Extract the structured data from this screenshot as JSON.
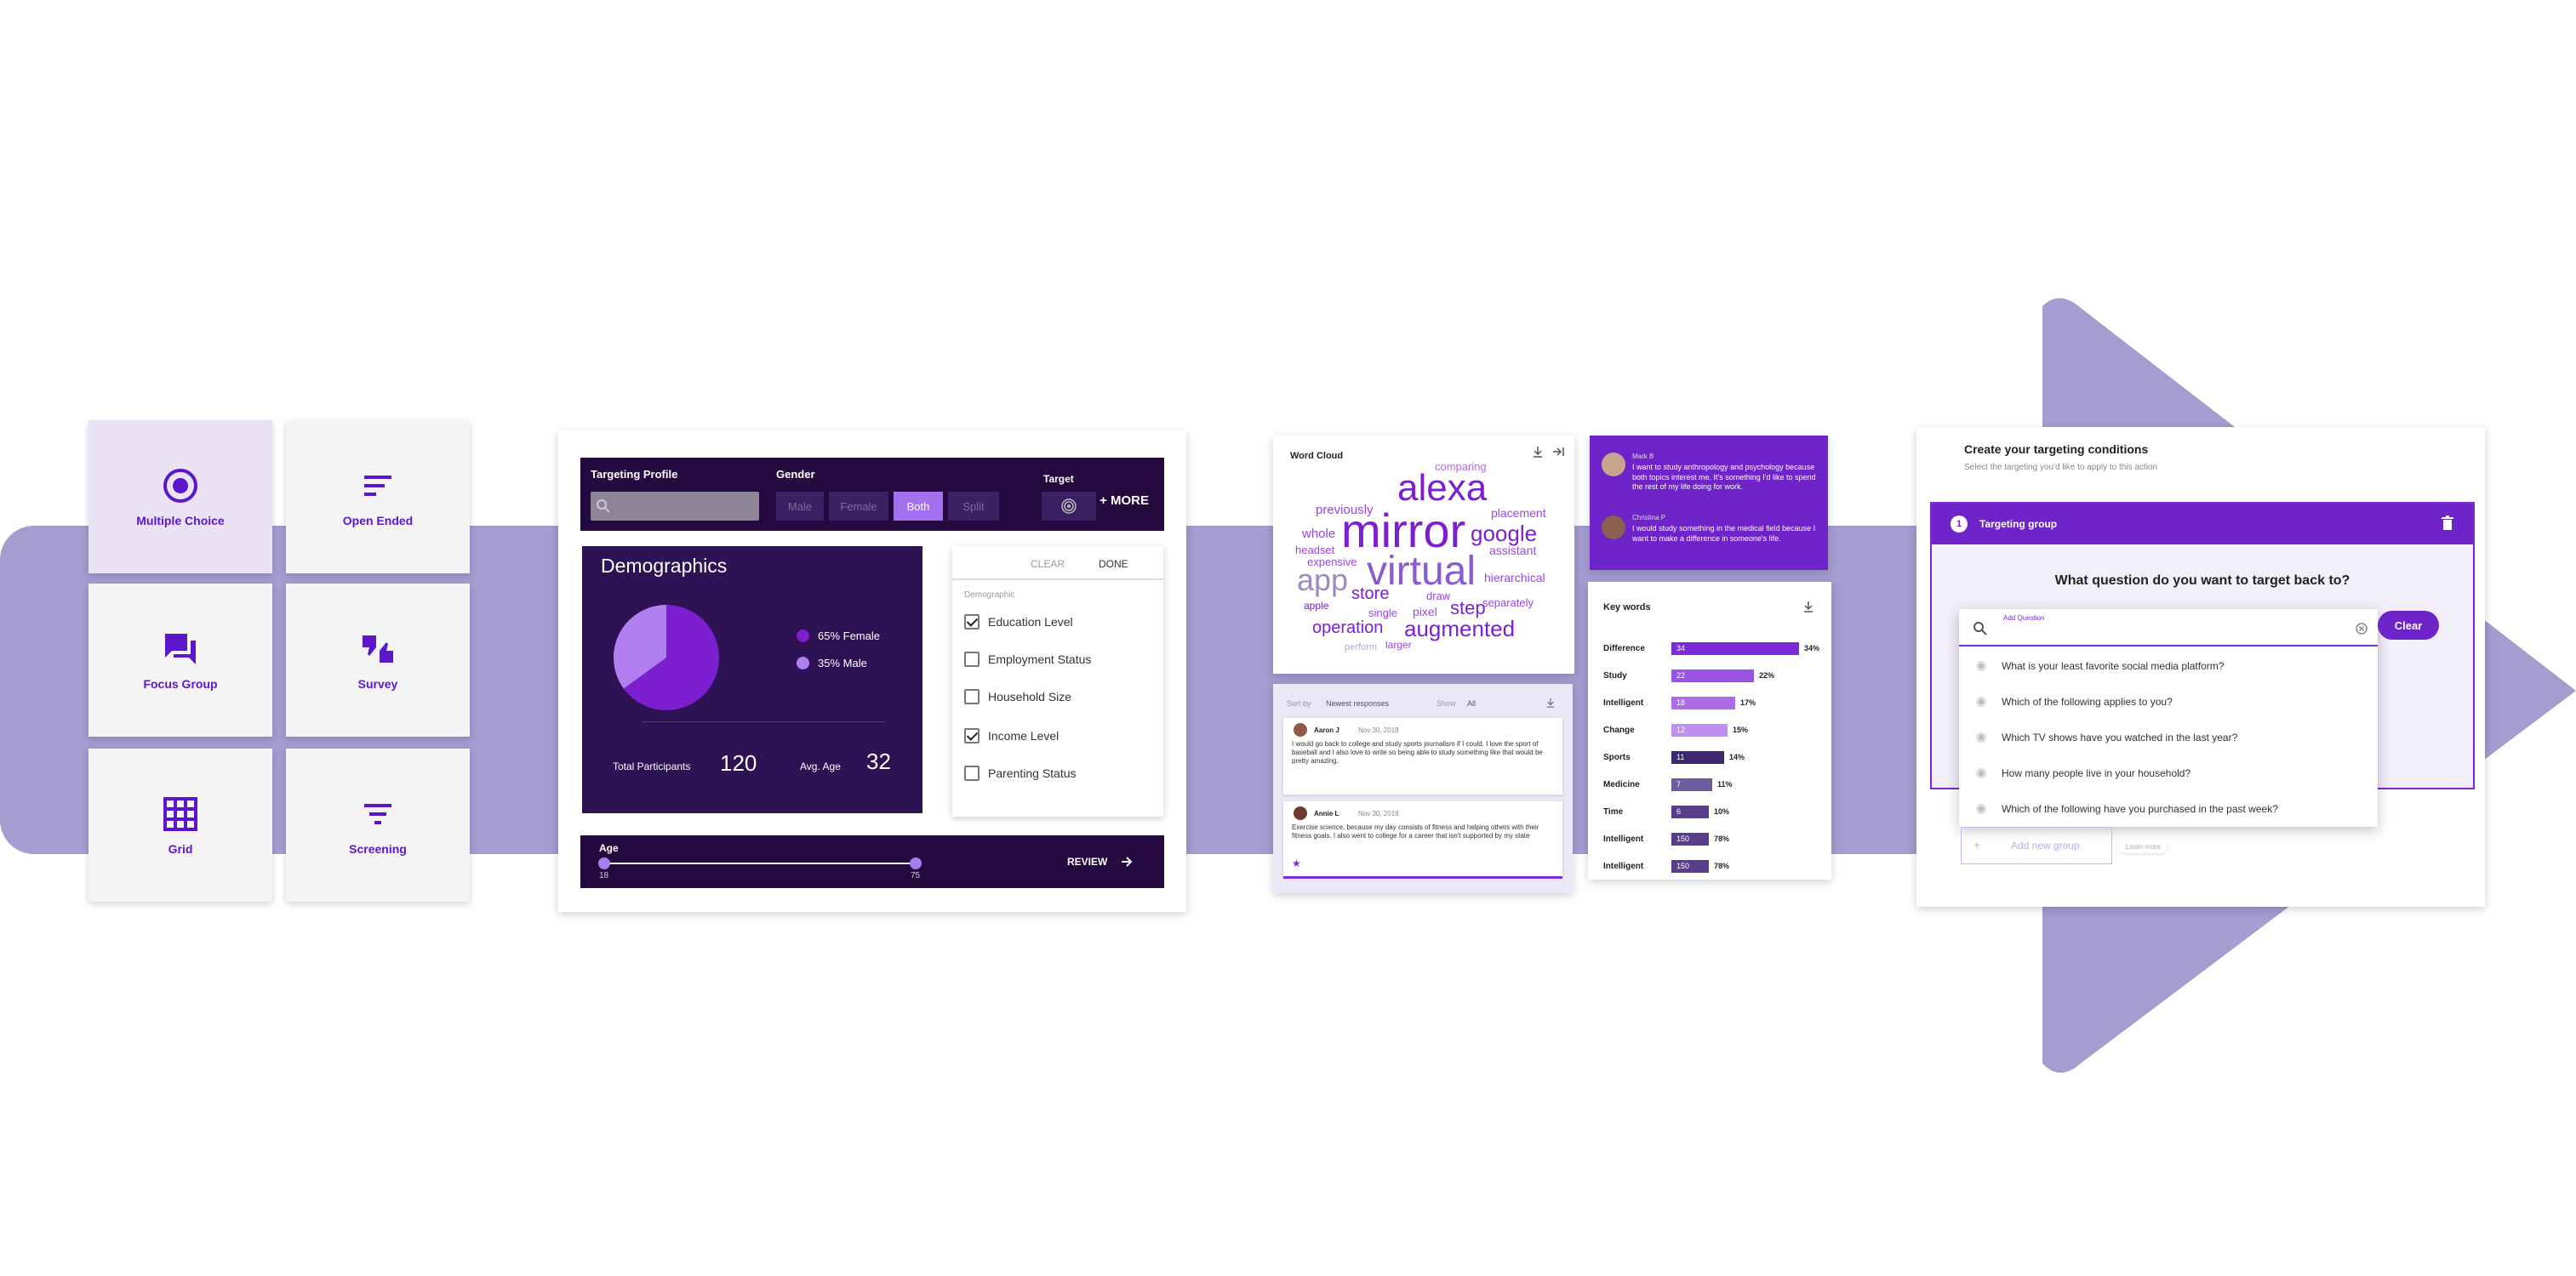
{
  "colors": {
    "accent": "#6e24c9",
    "dark": "#24093f",
    "background_band": "#a59cd0"
  },
  "question_types": [
    {
      "label": "Multiple Choice",
      "icon": "radio-icon",
      "selected": true
    },
    {
      "label": "Open Ended",
      "icon": "short-text-icon",
      "selected": false
    },
    {
      "label": "Focus Group",
      "icon": "forum-icon",
      "selected": false
    },
    {
      "label": "Survey",
      "icon": "thumbs-icon",
      "selected": false
    },
    {
      "label": "Grid",
      "icon": "grid-icon",
      "selected": false
    },
    {
      "label": "Screening",
      "icon": "filter-icon",
      "selected": false
    }
  ],
  "targeting": {
    "profile_label": "Targeting Profile",
    "gender_label": "Gender",
    "gender_options": [
      "Male",
      "Female",
      "Both",
      "Split"
    ],
    "gender_selected": "Both",
    "target_label": "Target",
    "more_label": "+ MORE"
  },
  "demographics": {
    "title": "Demographics",
    "legend": [
      "65% Female",
      "35% Male"
    ],
    "female_share": 0.65,
    "total_label": "Total Participants",
    "total_value": "120",
    "age_label": "Avg. Age",
    "age_value": "32"
  },
  "filters": {
    "clear_label": "CLEAR",
    "done_label": "DONE",
    "category": "Demographic",
    "items": [
      {
        "label": "Education Level",
        "checked": true
      },
      {
        "label": "Employment Status",
        "checked": false
      },
      {
        "label": "Household Size",
        "checked": false
      },
      {
        "label": "Income Level",
        "checked": true
      },
      {
        "label": "Parenting Status",
        "checked": false
      }
    ]
  },
  "age_range": {
    "label": "Age",
    "min": "18",
    "max": "75",
    "review_label": "REVIEW"
  },
  "word_cloud": {
    "title": "Word Cloud",
    "words": [
      "alexa",
      "mirror",
      "virtual",
      "google",
      "app",
      "augmented",
      "store",
      "step",
      "operation",
      "placement",
      "assistant",
      "hierarchical",
      "comparing",
      "previously",
      "whole",
      "headset",
      "expensive",
      "separately",
      "draw",
      "pixel",
      "single",
      "apple",
      "larger",
      "perform"
    ]
  },
  "responses": {
    "sort_label": "Sort by",
    "sort_value": "Newest responses",
    "show_label": "Show",
    "show_value": "All",
    "items": [
      {
        "name": "Aaron J",
        "date": "Nov 30, 2018",
        "text": "I would go back to college and study sports journalism if I could. I love the sport of baseball and I also love to write so being able to study something like that would be pretty amazing."
      },
      {
        "name": "Annie L",
        "date": "Nov 30, 2018",
        "text": "Exercise science, because my day consists of fitness and helping others with their fitness goals. I also went to college for a career that isn't supported by my state"
      }
    ]
  },
  "quotes": [
    {
      "name": "Mark B",
      "text": "I want to study anthropology and psychology because both topics interest me. It's something I'd like to spend the rest of my life doing for work."
    },
    {
      "name": "Christina P",
      "text": "I would study something in the medical field because I want to make a difference in someone's life."
    }
  ],
  "keywords": {
    "title": "Key words",
    "rows": [
      {
        "label": "Difference",
        "count": "34",
        "pct": "34%",
        "share": 0.34,
        "color": "#7b2bd6"
      },
      {
        "label": "Study",
        "count": "22",
        "pct": "22%",
        "share": 0.22,
        "color": "#9a53e3"
      },
      {
        "label": "Intelligent",
        "count": "18",
        "pct": "17%",
        "share": 0.17,
        "color": "#ad6be8"
      },
      {
        "label": "Change",
        "count": "12",
        "pct": "15%",
        "share": 0.15,
        "color": "#c08ff0"
      },
      {
        "label": "Sports",
        "count": "11",
        "pct": "14%",
        "share": 0.14,
        "color": "#3d2770"
      },
      {
        "label": "Medicine",
        "count": "7",
        "pct": "11%",
        "share": 0.11,
        "color": "#6e5a9e"
      },
      {
        "label": "Time",
        "count": "6",
        "pct": "10%",
        "share": 0.1,
        "color": "#5a3d8c"
      },
      {
        "label": "Intelligent",
        "count": "150",
        "pct": "78%",
        "share": 0.1,
        "color": "#5a3d8c"
      },
      {
        "label": "Intelligent",
        "count": "150",
        "pct": "78%",
        "share": 0.1,
        "color": "#5a3d8c"
      }
    ]
  },
  "conditions": {
    "title": "Create your targeting conditions",
    "subtitle": "Select the targeting you'd like to apply to this action",
    "group_number": "1",
    "group_title": "Targeting group",
    "question": "What question do you want  to target back to?",
    "input_label": "Add Question",
    "clear_label": "Clear",
    "options": [
      "What is your least favorite social media platform?",
      "Which of the following applies to you?",
      "Which TV shows have you watched in the last year?",
      "How many people live in your household?",
      "Which of the following have you purchased in the past week?"
    ],
    "add_group_label": "Add new group",
    "learn_more": "Learn more"
  }
}
